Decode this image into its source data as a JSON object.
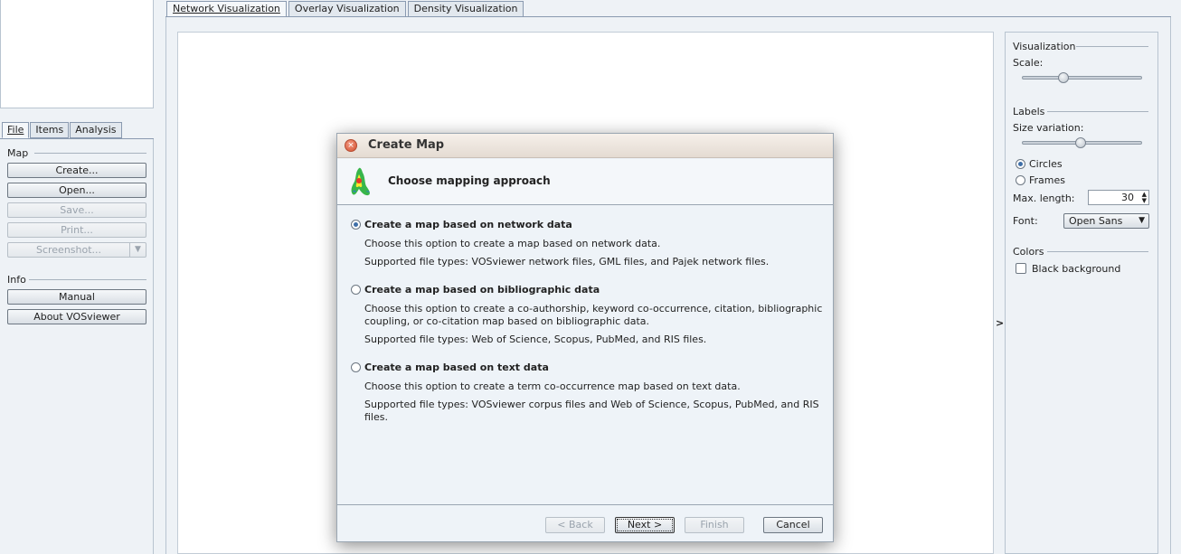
{
  "left_panel": {
    "tabs": [
      "File",
      "Items",
      "Analysis"
    ],
    "map_section": "Map",
    "buttons": {
      "create": "Create...",
      "open": "Open...",
      "save": "Save...",
      "print": "Print...",
      "screenshot": "Screenshot..."
    },
    "info_section": "Info",
    "info_buttons": {
      "manual": "Manual",
      "about": "About VOSviewer"
    }
  },
  "view_tabs": [
    "Network Visualization",
    "Overlay Visualization",
    "Density Visualization"
  ],
  "collapse_arrow": ">",
  "right_panel": {
    "visualization": "Visualization",
    "scale_label": "Scale:",
    "scale_level": 0.33,
    "labels": "Labels",
    "size_variation": "Size variation:",
    "size_variation_level": 0.49,
    "circles": "Circles",
    "frames": "Frames",
    "max_length_label": "Max. length:",
    "max_length_value": "30",
    "font_label": "Font:",
    "font_value": "Open Sans",
    "colors": "Colors",
    "black_background": "Black background"
  },
  "dialog": {
    "title": "Create Map",
    "heading": "Choose mapping approach",
    "options": [
      {
        "title": "Create a map based on network data",
        "desc": "Choose this option to create a map based on network data.",
        "types": "Supported file types: VOSviewer network files, GML files, and Pajek network files.",
        "selected": true
      },
      {
        "title": "Create a map based on bibliographic data",
        "desc": "Choose this option to create a co-authorship, keyword co-occurrence, citation, bibliographic coupling, or co-citation map based on bibliographic data.",
        "types": "Supported file types: Web of Science, Scopus, PubMed, and RIS files.",
        "selected": false
      },
      {
        "title": "Create a map based on text data",
        "desc": "Choose this option to create a term co-occurrence map based on text data.",
        "types": "Supported file types: VOSviewer corpus files and Web of Science, Scopus, PubMed, and RIS files.",
        "selected": false
      }
    ],
    "buttons": {
      "back": "< Back",
      "next": "Next >",
      "finish": "Finish",
      "cancel": "Cancel"
    }
  }
}
